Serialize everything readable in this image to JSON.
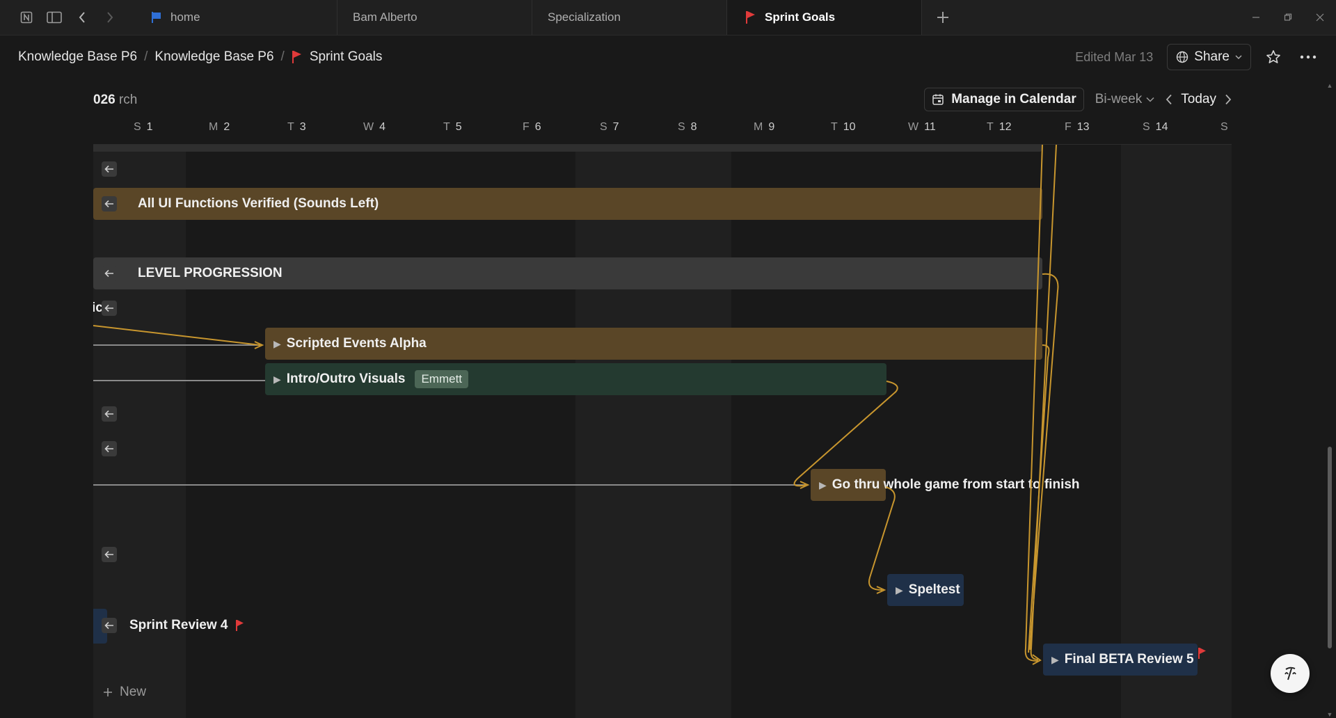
{
  "tabs": [
    {
      "label": "home",
      "icon": "flag-blue-icon"
    },
    {
      "label": "Bam Alberto",
      "icon": ""
    },
    {
      "label": "Specialization",
      "icon": ""
    },
    {
      "label": "Sprint Goals",
      "icon": "flag-red-icon",
      "active": true
    }
  ],
  "breadcrumb": {
    "items": [
      "Knowledge Base P6",
      "Knowledge Base P6",
      "Sprint Goals"
    ],
    "sep": "/"
  },
  "topbar": {
    "edited": "Edited Mar 13",
    "share": "Share"
  },
  "timeline": {
    "month_prefix": "026",
    "month_suffix": "rch",
    "manage": "Manage in Calendar",
    "view": "Bi-week",
    "today": "Today"
  },
  "days": [
    {
      "letter": "S",
      "num": "1"
    },
    {
      "letter": "M",
      "num": "2"
    },
    {
      "letter": "T",
      "num": "3"
    },
    {
      "letter": "W",
      "num": "4"
    },
    {
      "letter": "T",
      "num": "5"
    },
    {
      "letter": "F",
      "num": "6"
    },
    {
      "letter": "S",
      "num": "7"
    },
    {
      "letter": "S",
      "num": "8"
    },
    {
      "letter": "M",
      "num": "9"
    },
    {
      "letter": "T",
      "num": "10"
    },
    {
      "letter": "W",
      "num": "11"
    },
    {
      "letter": "T",
      "num": "12"
    },
    {
      "letter": "F",
      "num": "13"
    },
    {
      "letter": "S",
      "num": "14"
    },
    {
      "letter": "S",
      "num": ""
    }
  ],
  "rows": {
    "ui_verified": "All UI Functions Verified (Sounds Left)",
    "level_progression": "LEVEL PROGRESSION",
    "cut_label": "ic  d",
    "scripted_events": "Scripted Events Alpha",
    "intro_outro": "Intro/Outro Visuals",
    "intro_outro_tag": "Emmett",
    "go_thru": "Go thru whole game from start to finish",
    "speltest": "Speltest",
    "sprint_review": "Sprint Review 4",
    "final_beta": "Final BETA Review 5",
    "new": "New"
  },
  "colors": {
    "gold_bar": "#5a4627",
    "green_bar": "#243a30",
    "navy_bar": "#1f3048",
    "dependency_line": "#c8962e",
    "flag_red": "#e03a3a",
    "flag_blue": "#2f6fd6"
  }
}
